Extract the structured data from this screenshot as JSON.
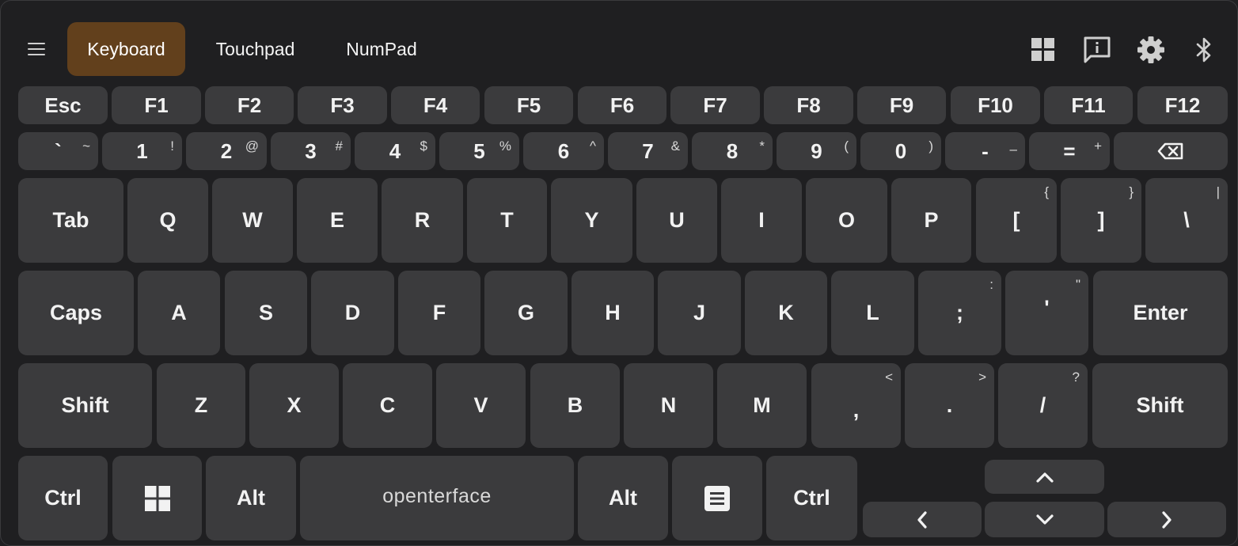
{
  "tabs": [
    {
      "label": "Keyboard",
      "active": true
    },
    {
      "label": "Touchpad",
      "active": false
    },
    {
      "label": "NumPad",
      "active": false
    }
  ],
  "toolbar_icons": [
    "grid-layout-icon",
    "feedback-info-icon",
    "gear-icon",
    "bluetooth-icon"
  ],
  "colors": {
    "background": "#1f1f21",
    "key": "#3b3b3d",
    "active_tab": "#62401c",
    "text": "#f2f2f2"
  },
  "keyboard": {
    "function_row": [
      "Esc",
      "F1",
      "F2",
      "F3",
      "F4",
      "F5",
      "F6",
      "F7",
      "F8",
      "F9",
      "F10",
      "F11",
      "F12"
    ],
    "number_row": [
      {
        "main": "`",
        "shift": "~"
      },
      {
        "main": "1",
        "shift": "!"
      },
      {
        "main": "2",
        "shift": "@"
      },
      {
        "main": "3",
        "shift": "#"
      },
      {
        "main": "4",
        "shift": "$"
      },
      {
        "main": "5",
        "shift": "%"
      },
      {
        "main": "6",
        "shift": "^"
      },
      {
        "main": "7",
        "shift": "&"
      },
      {
        "main": "8",
        "shift": "*"
      },
      {
        "main": "9",
        "shift": "("
      },
      {
        "main": "0",
        "shift": ")"
      },
      {
        "main": "-",
        "shift": "–"
      },
      {
        "main": "=",
        "shift": "+"
      }
    ],
    "backspace_icon": "backspace-icon",
    "tab_row": [
      {
        "main": "Tab",
        "shift": ""
      },
      {
        "main": "Q",
        "shift": ""
      },
      {
        "main": "W",
        "shift": ""
      },
      {
        "main": "E",
        "shift": ""
      },
      {
        "main": "R",
        "shift": ""
      },
      {
        "main": "T",
        "shift": ""
      },
      {
        "main": "Y",
        "shift": ""
      },
      {
        "main": "U",
        "shift": ""
      },
      {
        "main": "I",
        "shift": ""
      },
      {
        "main": "O",
        "shift": ""
      },
      {
        "main": "P",
        "shift": ""
      },
      {
        "main": "[",
        "shift": "{"
      },
      {
        "main": "]",
        "shift": "}"
      },
      {
        "main": "\\",
        "shift": "|"
      }
    ],
    "caps_row": [
      {
        "main": "Caps",
        "shift": ""
      },
      {
        "main": "A",
        "shift": ""
      },
      {
        "main": "S",
        "shift": ""
      },
      {
        "main": "D",
        "shift": ""
      },
      {
        "main": "F",
        "shift": ""
      },
      {
        "main": "G",
        "shift": ""
      },
      {
        "main": "H",
        "shift": ""
      },
      {
        "main": "J",
        "shift": ""
      },
      {
        "main": "K",
        "shift": ""
      },
      {
        "main": "L",
        "shift": ""
      },
      {
        "main": ";",
        "shift": ":"
      },
      {
        "main": "'",
        "shift": "\""
      },
      {
        "main": "Enter",
        "shift": ""
      }
    ],
    "shift_row": [
      {
        "main": "Shift",
        "shift": ""
      },
      {
        "main": "Z",
        "shift": ""
      },
      {
        "main": "X",
        "shift": ""
      },
      {
        "main": "C",
        "shift": ""
      },
      {
        "main": "V",
        "shift": ""
      },
      {
        "main": "B",
        "shift": ""
      },
      {
        "main": "N",
        "shift": ""
      },
      {
        "main": "M",
        "shift": ""
      },
      {
        "main": ",",
        "shift": "<"
      },
      {
        "main": ".",
        "shift": ">"
      },
      {
        "main": "/",
        "shift": "?"
      },
      {
        "main": "Shift",
        "shift": ""
      }
    ],
    "bottom_row": {
      "left_ctrl": "Ctrl",
      "win_icon": "windows-icon",
      "left_alt": "Alt",
      "space_label": "openterface",
      "right_alt": "Alt",
      "menu_icon": "menu-key-icon",
      "right_ctrl": "Ctrl"
    },
    "arrows": [
      "chevron-up-icon",
      "chevron-left-icon",
      "chevron-down-icon",
      "chevron-right-icon"
    ]
  }
}
